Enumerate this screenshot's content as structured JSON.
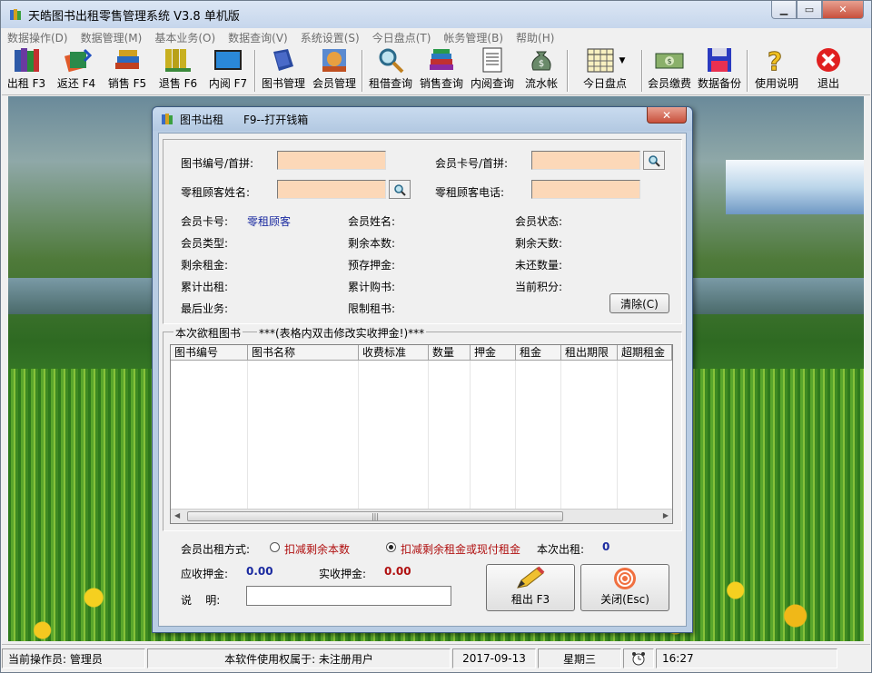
{
  "app": {
    "title": "天皓图书出租零售管理系统 V3.8 单机版",
    "window_controls": {
      "minimize": "▁",
      "restore": "▭",
      "close": "✕"
    }
  },
  "menu": [
    "数据操作(D)",
    "数据管理(M)",
    "基本业务(O)",
    "数据查询(V)",
    "系统设置(S)",
    "今日盘点(T)",
    "帐务管理(B)",
    "帮助(H)"
  ],
  "toolbar": [
    {
      "label": "出租 F3",
      "icon": "books-rent-icon"
    },
    {
      "label": "返还 F4",
      "icon": "books-return-icon"
    },
    {
      "label": "销售 F5",
      "icon": "books-sale-icon"
    },
    {
      "label": "退售 F6",
      "icon": "books-refund-icon"
    },
    {
      "label": "内阅 F7",
      "icon": "monitor-icon"
    },
    {
      "label": "图书管理",
      "icon": "book-manage-icon"
    },
    {
      "label": "会员管理",
      "icon": "member-manage-icon"
    },
    {
      "label": "租借查询",
      "icon": "search-magnifier-icon"
    },
    {
      "label": "销售查询",
      "icon": "sales-books-icon"
    },
    {
      "label": "内阅查询",
      "icon": "document-icon"
    },
    {
      "label": "流水帐",
      "icon": "money-bag-icon"
    },
    {
      "label": "今日盘点",
      "icon": "calendar-grid-icon"
    },
    {
      "label": "会员缴费",
      "icon": "cash-icon"
    },
    {
      "label": "数据备份",
      "icon": "floppy-disk-icon"
    },
    {
      "label": "使用说明",
      "icon": "help-question-icon"
    },
    {
      "label": "退出",
      "icon": "exit-x-icon"
    }
  ],
  "dialog": {
    "title": "图书出租",
    "hotkey_hint": "F9--打开钱箱",
    "close": "✕",
    "book_code_label": "图书编号/首拼:",
    "book_code_value": "",
    "member_card_label": "会员卡号/首拼:",
    "member_card_value": "",
    "guest_name_label": "零租顾客姓名:",
    "guest_name_value": "",
    "guest_phone_label": "零租顾客电话:",
    "guest_phone_value": "",
    "info": {
      "card_no_label": "会员卡号:",
      "card_no_value": "零租顾客",
      "member_name_label": "会员姓名:",
      "member_status_label": "会员状态:",
      "member_type_label": "会员类型:",
      "remaining_count_label": "剩余本数:",
      "remaining_days_label": "剩余天数:",
      "remaining_rent_label": "剩余租金:",
      "deposit_label": "预存押金:",
      "unreturned_label": "未还数量:",
      "total_rent_label": "累计出租:",
      "total_buy_label": "累计购书:",
      "points_label": "当前积分:",
      "last_business_label": "最后业务:",
      "limit_label": "限制租书:"
    },
    "clear_button": "清除(C)",
    "grid_title": "本次欲租图书",
    "grid_hint": "***(表格内双击修改实收押金!)***",
    "grid_headers": [
      "图书编号",
      "图书名称",
      "收费标准",
      "数量",
      "押金",
      "租金",
      "租出期限",
      "超期租金"
    ],
    "rent_mode_label": "会员出租方式:",
    "rent_mode_options": [
      "扣减剩余本数",
      "扣减剩余租金或现付租金"
    ],
    "rent_mode_selected": 1,
    "current_rent_label": "本次出租:",
    "current_rent_value": "0",
    "deposit_due_label": "应收押金:",
    "deposit_due_value": "0.00",
    "deposit_paid_label": "实收押金:",
    "deposit_paid_value": "0.00",
    "note_label": "说    明:",
    "note_value": "",
    "rent_button": "租出 F3",
    "close_button": "关闭(Esc)"
  },
  "status": {
    "operator": "当前操作员: 管理员",
    "license": "本软件使用权属于: 未注册用户",
    "date": "2017-09-13",
    "weekday": "星期三",
    "time": "16:27"
  }
}
